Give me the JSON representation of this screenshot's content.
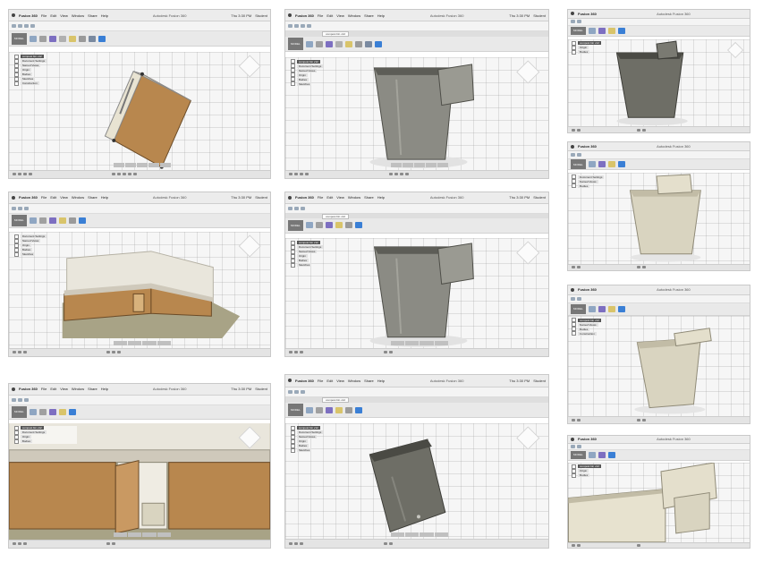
{
  "app": {
    "app_name": "Fusion 360",
    "window_title": "Autodesk Fusion 360",
    "menu_items": [
      "File",
      "Edit",
      "View",
      "Window",
      "Share",
      "Help"
    ],
    "clock": "Thu 3:30 PM",
    "user": "Student",
    "document_tab": "compost bin v12",
    "workspace": "MODEL",
    "browser_root": "compost bin v12",
    "browser_items": [
      "Document Settings",
      "Named Views",
      "Origin",
      "Bodies",
      "Sketches",
      "Construction"
    ]
  },
  "colors": {
    "bin_dark": "#6e6e66",
    "bin_light": "#d9d4c0",
    "wood": "#b8874e",
    "counter": "#cfc9bb",
    "floor": "#a8a386",
    "accent_blue": "#3a7fd5"
  },
  "screens": [
    {
      "id": "s1",
      "scene": "tilted wooden box with handle",
      "show_browser": true
    },
    {
      "id": "s2",
      "scene": "grey bin with hanger bracket",
      "show_browser": true
    },
    {
      "id": "s3",
      "scene": "dark grey bin with bracket",
      "show_browser": true
    },
    {
      "id": "s4",
      "scene": "corner kitchen cabinets",
      "show_browser": true
    },
    {
      "id": "s5",
      "scene": "grey bin with hanger bracket",
      "show_browser": true
    },
    {
      "id": "s6",
      "scene": "beige bin with bracket",
      "show_browser": true
    },
    {
      "id": "s7",
      "scene": "close-up cabinet with open door",
      "show_browser": true
    },
    {
      "id": "s8",
      "scene": "dark bin rotated",
      "show_browser": true
    },
    {
      "id": "s9",
      "scene": "beige bin angled",
      "show_browser": true
    },
    {
      "id": "s10",
      "scene": "close-up of bin rim and bracket",
      "show_browser": true
    }
  ]
}
